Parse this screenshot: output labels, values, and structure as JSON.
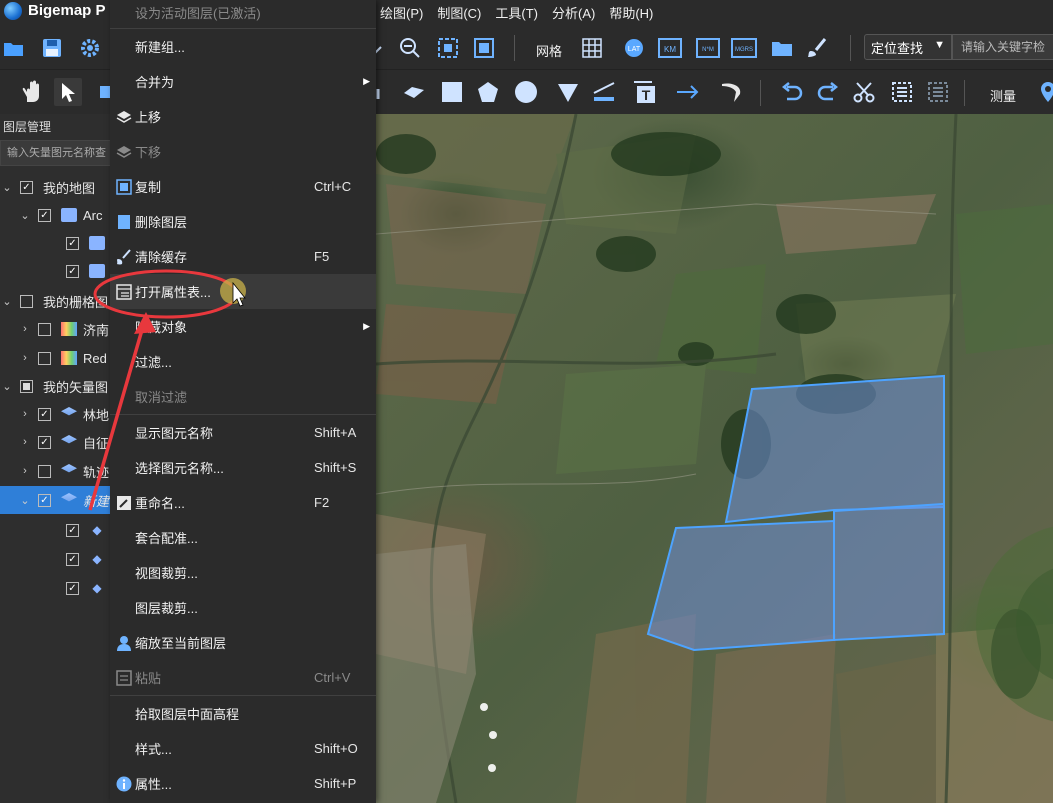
{
  "app": {
    "title": "Bigemap P"
  },
  "menubar": {
    "items": [
      "绘图(P)",
      "制图(C)",
      "工具(T)",
      "分析(A)",
      "帮助(H)"
    ]
  },
  "toolbar1": {
    "grid_label": "网格",
    "locate_label": "定位查找",
    "search_placeholder": "请输入关键字检"
  },
  "toolbar2": {
    "measure_label": "测量"
  },
  "layer_panel": {
    "title": "图层管理",
    "search_placeholder": "输入矢量图元名称查",
    "rows": [
      {
        "label": "我的地图"
      },
      {
        "label": "Arc"
      },
      {
        "label": ""
      },
      {
        "label": ""
      },
      {
        "label": "我的栅格图"
      },
      {
        "label": "济南"
      },
      {
        "label": "Red"
      },
      {
        "label": "我的矢量图"
      },
      {
        "label": "林地"
      },
      {
        "label": "自征"
      },
      {
        "label": "轨迹"
      },
      {
        "label": "新建"
      },
      {
        "label": ""
      },
      {
        "label": ""
      },
      {
        "label": ""
      }
    ]
  },
  "context_menu": {
    "items": [
      {
        "label": "设为活动图层(已激活)",
        "shortcut": ""
      },
      {
        "label": "新建组...",
        "shortcut": ""
      },
      {
        "label": "合并为",
        "shortcut": ""
      },
      {
        "label": "上移",
        "shortcut": ""
      },
      {
        "label": "下移",
        "shortcut": ""
      },
      {
        "label": "复制",
        "shortcut": "Ctrl+C"
      },
      {
        "label": "删除图层",
        "shortcut": ""
      },
      {
        "label": "清除缓存",
        "shortcut": "F5"
      },
      {
        "label": "打开属性表...",
        "shortcut": ""
      },
      {
        "label": "隐藏对象",
        "shortcut": ""
      },
      {
        "label": "过滤...",
        "shortcut": ""
      },
      {
        "label": "取消过滤",
        "shortcut": ""
      },
      {
        "label": "显示图元名称",
        "shortcut": "Shift+A"
      },
      {
        "label": "选择图元名称...",
        "shortcut": "Shift+S"
      },
      {
        "label": "重命名...",
        "shortcut": "F2"
      },
      {
        "label": "套合配准...",
        "shortcut": ""
      },
      {
        "label": "视图裁剪...",
        "shortcut": ""
      },
      {
        "label": "图层裁剪...",
        "shortcut": ""
      },
      {
        "label": "缩放至当前图层",
        "shortcut": ""
      },
      {
        "label": "粘贴",
        "shortcut": "Ctrl+V"
      },
      {
        "label": "拾取图层中面高程",
        "shortcut": ""
      },
      {
        "label": "样式...",
        "shortcut": "Shift+O"
      },
      {
        "label": "属性...",
        "shortcut": "Shift+P"
      }
    ]
  },
  "colors": {
    "accent": "#2f7fd8",
    "annotation": "#e8383d",
    "polygon_stroke": "#4da3ff"
  }
}
